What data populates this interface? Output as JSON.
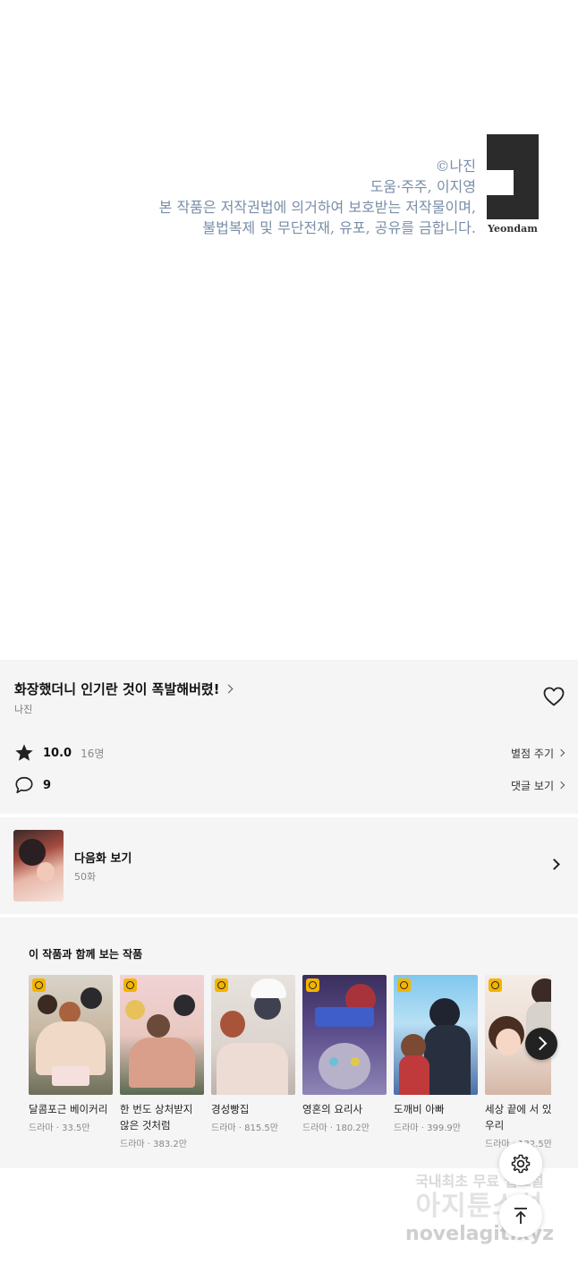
{
  "copyright": {
    "line1": "©나진",
    "line2": "도움·주주, 이지영",
    "line3": "본 작품은 저작권법에 의거하여 보호받는 저작물이며,",
    "line4": "불법복제 및 무단전재, 유포, 공유를 금합니다.",
    "logo_text": "Yeondam"
  },
  "series": {
    "title": "화장했더니 인기란 것이 폭발해버렸!",
    "author": "나진",
    "rating": "10.0",
    "raters": "16명",
    "rate_link": "별점 주기",
    "comments": "9",
    "comments_link": "댓글 보기"
  },
  "next": {
    "title": "다음화 보기",
    "episode": "50화"
  },
  "related": {
    "heading": "이 작품과 함께 보는 작품",
    "items": [
      {
        "title": "달콤포근 베이커리",
        "meta": "드라마 · 33.5만"
      },
      {
        "title": "한 번도 상처받지 않은 것처럼",
        "meta": "드라마 · 383.2만"
      },
      {
        "title": "경성빵집",
        "meta": "드라마 · 815.5만"
      },
      {
        "title": "영혼의 요리사",
        "meta": "드라마 · 180.2만"
      },
      {
        "title": "도깨비 아빠",
        "meta": "드라마 · 399.9만"
      },
      {
        "title": "세상 끝에 서 있는 우리",
        "meta": "드라마 · 132.5만"
      }
    ]
  },
  "watermark": {
    "line1": "국내최초 무료 웹소설",
    "line2": "아지툰소설",
    "line3": "novelagit.xyz"
  },
  "icons": [
    "heart-icon",
    "star-icon",
    "comment-icon",
    "chevron-right-icon",
    "gear-icon",
    "arrow-up-icon",
    "clock-badge-icon"
  ]
}
